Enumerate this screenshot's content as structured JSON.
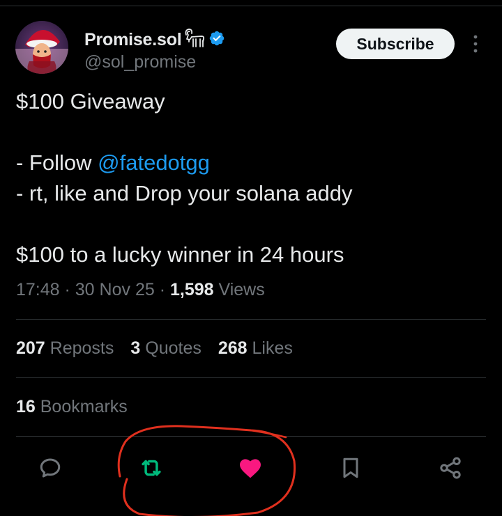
{
  "post": {
    "author": {
      "name": "Promise.sol",
      "handle": "@sol_promise",
      "verified": true,
      "name_emoji_icon": "goat-icon"
    },
    "subscribe_label": "Subscribe",
    "text": {
      "line1": "$100 Giveaway",
      "line2_prefix": "- Follow ",
      "line2_mention": "@fatedotgg",
      "line3": "- rt, like and Drop your solana addy",
      "line4": "$100 to a lucky winner in 24 hours"
    },
    "meta": {
      "time": "17:48",
      "sep1": " · ",
      "date": "30 Nov 25",
      "sep2": " · ",
      "views_count": "1,598",
      "views_label": " Views"
    },
    "stats": {
      "reposts_count": "207",
      "reposts_label": " Reposts",
      "quotes_count": "3",
      "quotes_label": " Quotes",
      "likes_count": "268",
      "likes_label": " Likes",
      "bookmarks_count": "16",
      "bookmarks_label": " Bookmarks"
    },
    "actions": [
      "reply-icon",
      "repost-icon",
      "like-icon",
      "bookmark-icon",
      "share-icon"
    ]
  },
  "colors": {
    "background": "#000000",
    "text": "#e7e9ea",
    "muted": "#71767b",
    "link": "#1d9bf0",
    "verified": "#1d9bf0",
    "repost_active": "#00ba7c",
    "like_active": "#f91880",
    "annotation": "#e0301e"
  }
}
